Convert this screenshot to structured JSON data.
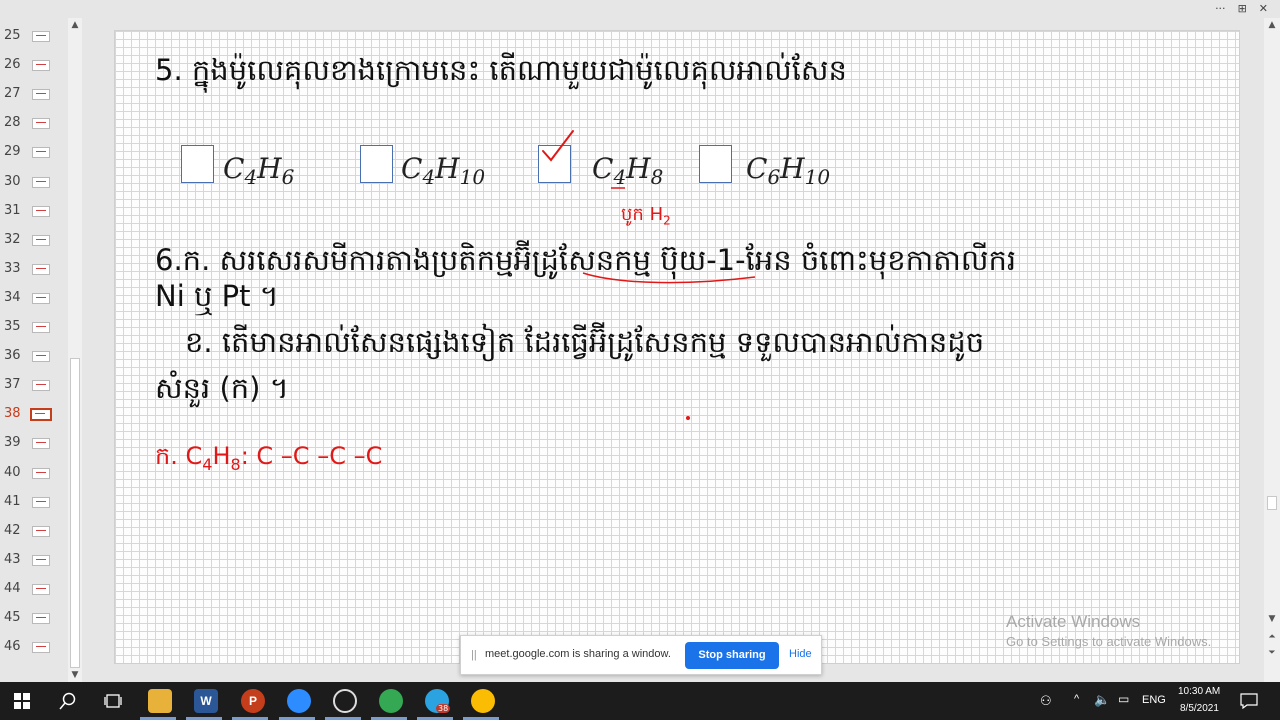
{
  "window_controls": [
    "···",
    "⊞",
    "✕"
  ],
  "thumbnails": {
    "numbers": [
      "25",
      "26",
      "27",
      "28",
      "29",
      "30",
      "31",
      "32",
      "33",
      "34",
      "35",
      "36",
      "37",
      "38",
      "39",
      "40",
      "41",
      "42",
      "43",
      "44",
      "45",
      "46"
    ],
    "active": "38"
  },
  "slide": {
    "q5_text": "5.  ក្នុងម៉ូលេគុលខាងក្រោមនេះ តើណាមួយជាម៉ូលេគុលអាល់សែន",
    "options": [
      {
        "c": "C",
        "c_sub": "4",
        "h": "H",
        "h_sub": "6",
        "checked": false
      },
      {
        "c": "C",
        "c_sub": "4",
        "h": "H",
        "h_sub": "10",
        "checked": false
      },
      {
        "c": "C",
        "c_sub": "4",
        "h": "H",
        "h_sub": "8",
        "checked": true
      },
      {
        "c": "C",
        "c_sub": "6",
        "h": "H",
        "h_sub": "10",
        "checked": false
      }
    ],
    "q6a_line1": "6.ក. សរសេរសមីការតាងប្រតិកម្មអ៊ីដ្រូសែនកម្ម ប៊ុយ-1-អែន ចំពោះមុខកាតាលីករ",
    "q6a_line2": "Ni ឬ Pt ។",
    "q6b_line1": "ខ. តើមានអាល់សែនផ្សេងទៀត ដែរធ្វើអ៊ីដ្រូសែនកម្ម ទទួលបានអាល់កានដូច",
    "q6b_line2": "សំនួរ (ក) ។",
    "ink_annotation_top": "បូក H",
    "ink_annotation_top_sub": "2",
    "ink_answer_label": "ក.",
    "ink_answer_formula": "C",
    "ink_answer_c_sub": "4",
    "ink_answer_h": "H",
    "ink_answer_h_sub": "8",
    "ink_answer_chain": ": C –C  –C  –C"
  },
  "watermark": {
    "line1": "Activate Windows",
    "line2": "Go to Settings to activate Windows."
  },
  "share_bar": {
    "grip": "||",
    "message": "meet.google.com is sharing a window.",
    "stop_label": "Stop sharing",
    "hide_label": "Hide"
  },
  "taskbar": {
    "telegram_badge": "38",
    "language": "ENG",
    "time": "10:30 AM",
    "date": "8/5/2021"
  },
  "colors": {
    "ink": "#e01818",
    "accent": "#1a73e8",
    "active_thumb": "#c43e1c"
  }
}
